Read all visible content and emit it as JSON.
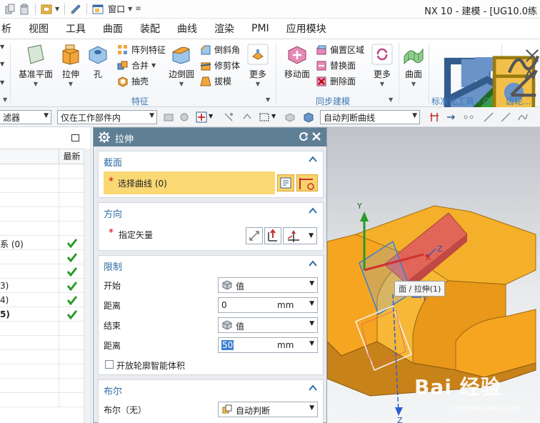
{
  "titlebar": {
    "window_menu_label": "窗口",
    "app_title": "NX 10 - 建模 - [UG10.0练"
  },
  "menubar": {
    "items": [
      "析",
      "视图",
      "工具",
      "曲面",
      "装配",
      "曲线",
      "渲染",
      "PMI",
      "应用模块"
    ]
  },
  "ribbon": {
    "datum_plane": "基准平面",
    "extrude": "拉伸",
    "hole": "孔",
    "pattern_feature": "阵列特征",
    "unite": "合并",
    "shell": "抽壳",
    "edge_blend": "边倒圆",
    "chamfer": "倒斜角",
    "trim_body": "修剪体",
    "draft": "拔模",
    "more_1": "更多",
    "move_face": "移动面",
    "offset_region": "偏置区域",
    "replace_face": "替换面",
    "delete_face": "删除面",
    "more_2": "更多",
    "surface": "曲面",
    "group_feature": "特征",
    "group_sync": "同步建模",
    "group_std": "标准化工具 - G...",
    "group_gear": "齿轮..."
  },
  "selbar": {
    "filter_label": "滤器",
    "scope_value": "仅在工作部件内",
    "curve_rule": "自动判断曲线"
  },
  "navigator": {
    "col_latest": "最新",
    "rows": [
      {
        "text": "",
        "check": false,
        "bold": false
      },
      {
        "text": "",
        "check": false,
        "bold": false
      },
      {
        "text": "",
        "check": false,
        "bold": false
      },
      {
        "text": "",
        "check": false,
        "bold": false
      },
      {
        "text": "",
        "check": false,
        "bold": false
      },
      {
        "text": "系 (0)",
        "check": true,
        "bold": false
      },
      {
        "text": "",
        "check": true,
        "bold": false
      },
      {
        "text": "",
        "check": true,
        "bold": false
      },
      {
        "text": "3)",
        "check": true,
        "bold": false
      },
      {
        "text": "4)",
        "check": true,
        "bold": false
      },
      {
        "text": "5)",
        "check": true,
        "bold": true
      },
      {
        "text": "",
        "check": false,
        "bold": false
      },
      {
        "text": "",
        "check": false,
        "bold": false
      },
      {
        "text": "",
        "check": false,
        "bold": false
      },
      {
        "text": "",
        "check": false,
        "bold": false
      },
      {
        "text": "",
        "check": false,
        "bold": false
      },
      {
        "text": "",
        "check": false,
        "bold": false
      }
    ]
  },
  "dialog": {
    "title": "拉伸",
    "section_label": "截面",
    "select_curve": "选择曲线 (0)",
    "direction_label": "方向",
    "specify_vector": "指定矢量",
    "limits_label": "限制",
    "start_label": "开始",
    "start_value": "值",
    "distance_label": "距离",
    "start_distance": "0",
    "end_label": "结束",
    "end_value": "值",
    "end_distance": "50",
    "unit": "mm",
    "open_profile": "开放轮廓智能体积",
    "boolean_label": "布尔",
    "boolean_field": "布尔（无）",
    "boolean_value": "自动判断",
    "required_mark": "*"
  },
  "graphics": {
    "tooltip": "面 / 拉伸(1)",
    "axis_x": "X",
    "axis_y": "Y",
    "axis_z": "Z",
    "axis_zc": "Z",
    "axis_yc": "Y",
    "watermark": "Bai 经验",
    "watermark_sub": "jingyan.baidu.com"
  },
  "colors": {
    "dialog_title": "#5f7f95",
    "section_title": "#2f6ea5",
    "selection_highlight": "#fad873",
    "part_orange": "#f5a51f",
    "preview_red": "#e0605c",
    "check_green": "#2a9a2a"
  }
}
